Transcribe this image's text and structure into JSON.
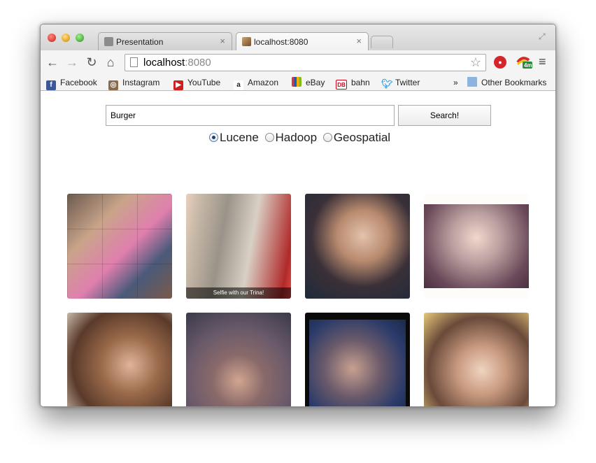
{
  "tabs": [
    {
      "title": "Presentation",
      "active": false
    },
    {
      "title": "localhost:8080",
      "active": true
    }
  ],
  "omnibox": {
    "host": "localhost",
    "port": ":8080"
  },
  "bookmarks": [
    {
      "label": "Facebook",
      "icon": "facebook-icon",
      "color": "#3b5998"
    },
    {
      "label": "Instagram",
      "icon": "instagram-icon",
      "color": "#8a6a4a"
    },
    {
      "label": "YouTube",
      "icon": "youtube-icon",
      "color": "#cc1f1f"
    },
    {
      "label": "Amazon",
      "icon": "amazon-icon",
      "color": "#222222"
    },
    {
      "label": "eBay",
      "icon": "ebay-icon",
      "color": "#e53238"
    },
    {
      "label": "bahn",
      "icon": "db-bahn-icon",
      "color": "#d5001c"
    },
    {
      "label": "Twitter",
      "icon": "twitter-icon",
      "color": "#2ba8e5"
    }
  ],
  "bookmarks_overflow": "»",
  "other_bookmarks": "Other Bookmarks",
  "search": {
    "value": "Burger",
    "button": "Search!"
  },
  "radios": [
    {
      "label": "Lucene",
      "checked": true
    },
    {
      "label": "Hadoop",
      "checked": false
    },
    {
      "label": "Geospatial",
      "checked": false
    }
  ],
  "results": [
    {
      "caption": ""
    },
    {
      "caption": "Selfie with our Trina!"
    },
    {
      "caption": ""
    },
    {
      "caption": ""
    },
    {
      "caption": ""
    },
    {
      "caption": ""
    },
    {
      "caption": ""
    },
    {
      "caption": ""
    }
  ]
}
